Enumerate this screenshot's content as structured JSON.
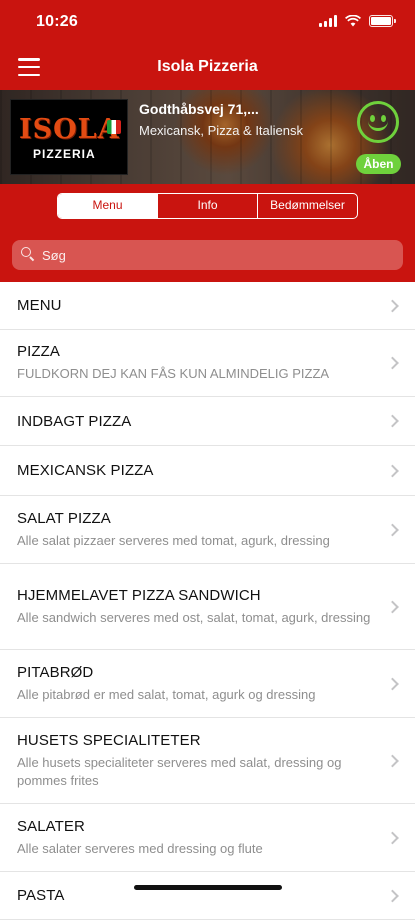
{
  "status_bar": {
    "time": "10:26"
  },
  "nav": {
    "title": "Isola Pizzeria"
  },
  "hero": {
    "logo_text": "ISOLA",
    "logo_subtext": "PIZZERIA",
    "address": "Godthåbsvej 71,...",
    "cuisine": "Mexicansk, Pizza & Italiensk",
    "status_badge": "Åben",
    "status_color": "#6fd13c"
  },
  "tabs": [
    {
      "label": "Menu",
      "active": true
    },
    {
      "label": "Info",
      "active": false
    },
    {
      "label": "Bedømmelser",
      "active": false
    }
  ],
  "search": {
    "placeholder": "Søg"
  },
  "categories": [
    {
      "title": "MENU",
      "subtitle": ""
    },
    {
      "title": "PIZZA",
      "subtitle": "FULDKORN DEJ KAN FÅS KUN ALMINDELIG PIZZA"
    },
    {
      "title": "INDBAGT PIZZA",
      "subtitle": ""
    },
    {
      "title": "MEXICANSK PIZZA",
      "subtitle": ""
    },
    {
      "title": "SALAT PIZZA",
      "subtitle": "Alle salat pizzaer serveres med tomat, agurk, dressing"
    },
    {
      "title": "HJEMMELAVET PIZZA SANDWICH",
      "subtitle": "Alle sandwich serveres med ost, salat, tomat, agurk, dressing"
    },
    {
      "title": "PITABRØD",
      "subtitle": "Alle pitabrød er med salat, tomat, agurk og dressing"
    },
    {
      "title": "HUSETS SPECIALITETER",
      "subtitle": "Alle husets specialiteter serveres med salat, dressing og pommes frites"
    },
    {
      "title": "SALATER",
      "subtitle": "Alle salater serveres med dressing og flute"
    },
    {
      "title": "PASTA",
      "subtitle": ""
    }
  ],
  "colors": {
    "primary": "#c9140f",
    "open_green": "#6fd13c"
  }
}
